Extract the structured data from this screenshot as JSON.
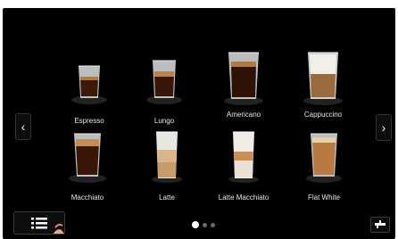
{
  "carousel": {
    "prev_icon": "chevron-left-icon",
    "next_icon": "chevron-right-icon",
    "prev_glyph": "‹",
    "next_glyph": "›"
  },
  "drinks": [
    {
      "label": "Espresso"
    },
    {
      "label": "Lungo"
    },
    {
      "label": "Americano"
    },
    {
      "label": "Cappuccino"
    },
    {
      "label": "Macchiato"
    },
    {
      "label": "Latte"
    },
    {
      "label": "Latte Macchiato"
    },
    {
      "label": "Flat White"
    }
  ],
  "pagination": {
    "page_count": 3,
    "current_page": 1
  },
  "footer": {
    "menu_icon": "list-menu-icon",
    "service_icon": "tap-icon"
  },
  "colors": {
    "background": "#000000",
    "text": "#e8e8e8",
    "dot_active": "#ffffff",
    "dot_inactive": "#6a6a6a"
  }
}
